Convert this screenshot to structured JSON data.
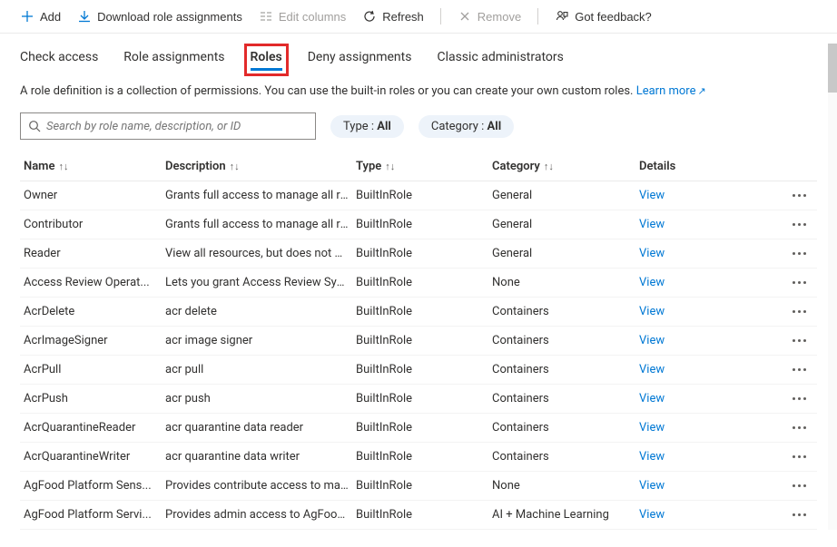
{
  "toolbar": {
    "add": "Add",
    "download": "Download role assignments",
    "edit_columns": "Edit columns",
    "refresh": "Refresh",
    "remove": "Remove",
    "feedback": "Got feedback?"
  },
  "tabs": {
    "check_access": "Check access",
    "role_assignments": "Role assignments",
    "roles": "Roles",
    "deny_assignments": "Deny assignments",
    "classic": "Classic administrators"
  },
  "desc_text": "A role definition is a collection of permissions. You can use the built-in roles or you can create your own custom roles.",
  "learn_more": "Learn more",
  "search": {
    "placeholder": "Search by role name, description, or ID"
  },
  "filters": {
    "type_label": "Type : ",
    "type_value": "All",
    "category_label": "Category : ",
    "category_value": "All"
  },
  "columns": {
    "name": "Name",
    "description": "Description",
    "type": "Type",
    "category": "Category",
    "details": "Details"
  },
  "view_label": "View",
  "rows": [
    {
      "name": "Owner",
      "desc": "Grants full access to manage all res...",
      "type": "BuiltInRole",
      "category": "General"
    },
    {
      "name": "Contributor",
      "desc": "Grants full access to manage all res...",
      "type": "BuiltInRole",
      "category": "General"
    },
    {
      "name": "Reader",
      "desc": "View all resources, but does not all...",
      "type": "BuiltInRole",
      "category": "General"
    },
    {
      "name": "Access Review Operat...",
      "desc": "Lets you grant Access Review Syste...",
      "type": "BuiltInRole",
      "category": "None"
    },
    {
      "name": "AcrDelete",
      "desc": "acr delete",
      "type": "BuiltInRole",
      "category": "Containers"
    },
    {
      "name": "AcrImageSigner",
      "desc": "acr image signer",
      "type": "BuiltInRole",
      "category": "Containers"
    },
    {
      "name": "AcrPull",
      "desc": "acr pull",
      "type": "BuiltInRole",
      "category": "Containers"
    },
    {
      "name": "AcrPush",
      "desc": "acr push",
      "type": "BuiltInRole",
      "category": "Containers"
    },
    {
      "name": "AcrQuarantineReader",
      "desc": "acr quarantine data reader",
      "type": "BuiltInRole",
      "category": "Containers"
    },
    {
      "name": "AcrQuarantineWriter",
      "desc": "acr quarantine data writer",
      "type": "BuiltInRole",
      "category": "Containers"
    },
    {
      "name": "AgFood Platform Sens...",
      "desc": "Provides contribute access to man...",
      "type": "BuiltInRole",
      "category": "None"
    },
    {
      "name": "AgFood Platform Servi...",
      "desc": "Provides admin access to AgFood ...",
      "type": "BuiltInRole",
      "category": "AI + Machine Learning"
    }
  ]
}
